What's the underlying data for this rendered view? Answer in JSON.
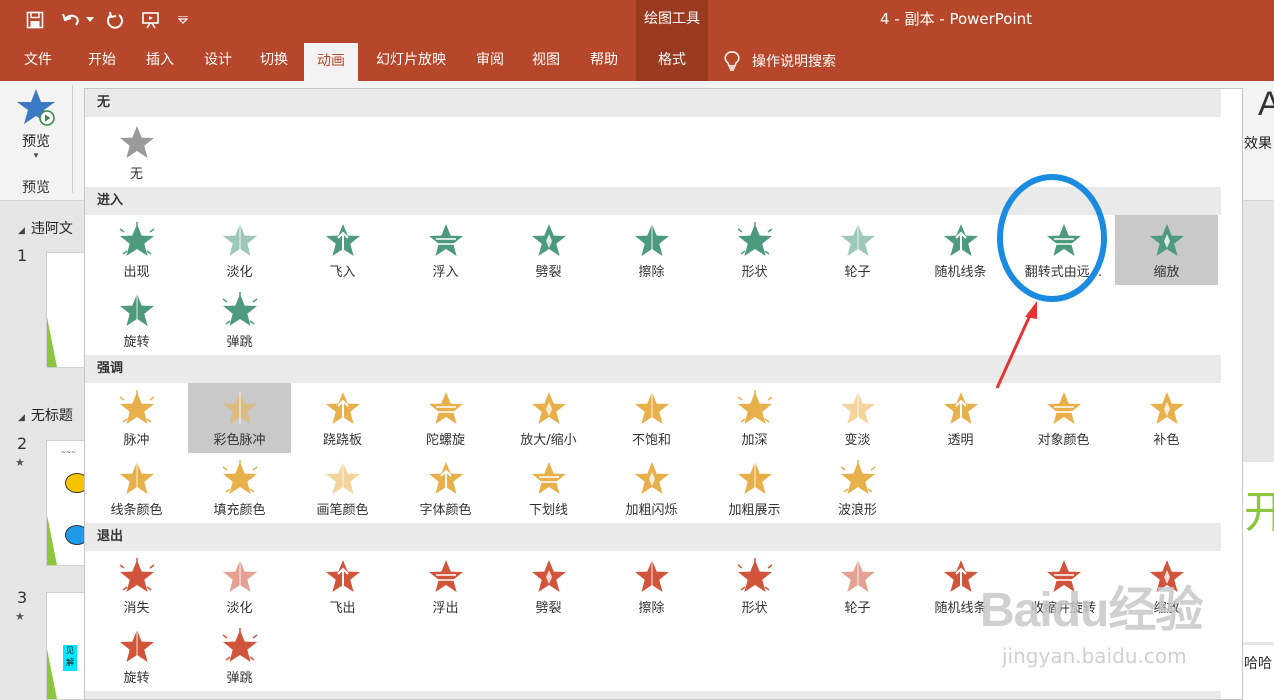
{
  "titlebar": {
    "context_tools": "绘图工具",
    "document_title": "4 - 副本  -  PowerPoint"
  },
  "tabs": [
    {
      "label": "文件"
    },
    {
      "label": "开始"
    },
    {
      "label": "插入"
    },
    {
      "label": "设计"
    },
    {
      "label": "切换"
    },
    {
      "label": "动画"
    },
    {
      "label": "幻灯片放映"
    },
    {
      "label": "审阅"
    },
    {
      "label": "视图"
    },
    {
      "label": "帮助"
    },
    {
      "label": "格式"
    }
  ],
  "tellme": "操作说明搜索",
  "ribbon": {
    "preview_label": "预览",
    "preview_group": "预览",
    "right_letter": "A",
    "right_effect": "效果"
  },
  "slides_panel": {
    "section1": "违阿文",
    "section2": "无标题",
    "slide_numbers": [
      "1",
      "2",
      "3"
    ],
    "anim_star": "★",
    "thumb3_text": "见解"
  },
  "canvas_right": {
    "glyph": "开",
    "bottom_text": "哈哈"
  },
  "colors": {
    "accent": "#b7472a",
    "none": "#9a9a9a",
    "entrance": "#4e9a7f",
    "emphasis": "#e8b04a",
    "exit": "#d0553a",
    "annotation": "#1a8be0",
    "arrow": "#e53333"
  },
  "gallery": {
    "none_title": "无",
    "none_items": [
      {
        "label": "无",
        "icon": "star-gray-icon"
      }
    ],
    "entrance_title": "进入",
    "entrance_items": [
      {
        "label": "出现",
        "icon": "appear-icon"
      },
      {
        "label": "淡化",
        "icon": "fade-icon"
      },
      {
        "label": "飞入",
        "icon": "fly-in-icon"
      },
      {
        "label": "浮入",
        "icon": "float-in-icon"
      },
      {
        "label": "劈裂",
        "icon": "split-icon"
      },
      {
        "label": "擦除",
        "icon": "wipe-icon"
      },
      {
        "label": "形状",
        "icon": "shape-icon"
      },
      {
        "label": "轮子",
        "icon": "wheel-icon"
      },
      {
        "label": "随机线条",
        "icon": "random-bars-icon"
      },
      {
        "label": "翻转式由远...",
        "icon": "grow-turn-icon"
      },
      {
        "label": "缩放",
        "icon": "zoom-icon"
      },
      {
        "label": "旋转",
        "icon": "swivel-icon"
      },
      {
        "label": "弹跳",
        "icon": "bounce-icon"
      }
    ],
    "emphasis_title": "强调",
    "emphasis_items": [
      {
        "label": "脉冲",
        "icon": "pulse-icon"
      },
      {
        "label": "彩色脉冲",
        "icon": "color-pulse-icon"
      },
      {
        "label": "跷跷板",
        "icon": "teeter-icon"
      },
      {
        "label": "陀螺旋",
        "icon": "spin-icon"
      },
      {
        "label": "放大/缩小",
        "icon": "grow-shrink-icon"
      },
      {
        "label": "不饱和",
        "icon": "desaturate-icon"
      },
      {
        "label": "加深",
        "icon": "darken-icon"
      },
      {
        "label": "变淡",
        "icon": "lighten-icon"
      },
      {
        "label": "透明",
        "icon": "transparency-icon"
      },
      {
        "label": "对象颜色",
        "icon": "object-color-icon"
      },
      {
        "label": "补色",
        "icon": "complementary-color-icon"
      },
      {
        "label": "线条颜色",
        "icon": "line-color-icon"
      },
      {
        "label": "填充颜色",
        "icon": "fill-color-icon"
      },
      {
        "label": "画笔颜色",
        "icon": "brush-color-icon"
      },
      {
        "label": "字体颜色",
        "icon": "font-color-icon"
      },
      {
        "label": "下划线",
        "icon": "underline-icon"
      },
      {
        "label": "加粗闪烁",
        "icon": "bold-flash-icon"
      },
      {
        "label": "加粗展示",
        "icon": "bold-reveal-icon"
      },
      {
        "label": "波浪形",
        "icon": "wave-icon"
      }
    ],
    "exit_title": "退出",
    "exit_items": [
      {
        "label": "消失",
        "icon": "disappear-icon"
      },
      {
        "label": "淡化",
        "icon": "fade-out-icon"
      },
      {
        "label": "飞出",
        "icon": "fly-out-icon"
      },
      {
        "label": "浮出",
        "icon": "float-out-icon"
      },
      {
        "label": "劈裂",
        "icon": "split-out-icon"
      },
      {
        "label": "擦除",
        "icon": "wipe-out-icon"
      },
      {
        "label": "形状",
        "icon": "shape-out-icon"
      },
      {
        "label": "轮子",
        "icon": "wheel-out-icon"
      },
      {
        "label": "随机线条",
        "icon": "random-bars-out-icon"
      },
      {
        "label": "收缩并旋转",
        "icon": "shrink-turn-icon"
      },
      {
        "label": "缩放",
        "icon": "zoom-out-icon"
      },
      {
        "label": "旋转",
        "icon": "swivel-out-icon"
      },
      {
        "label": "弹跳",
        "icon": "bounce-out-icon"
      }
    ]
  },
  "watermark": {
    "brand": "Baidu经验",
    "url": "jingyan.baidu.com"
  }
}
